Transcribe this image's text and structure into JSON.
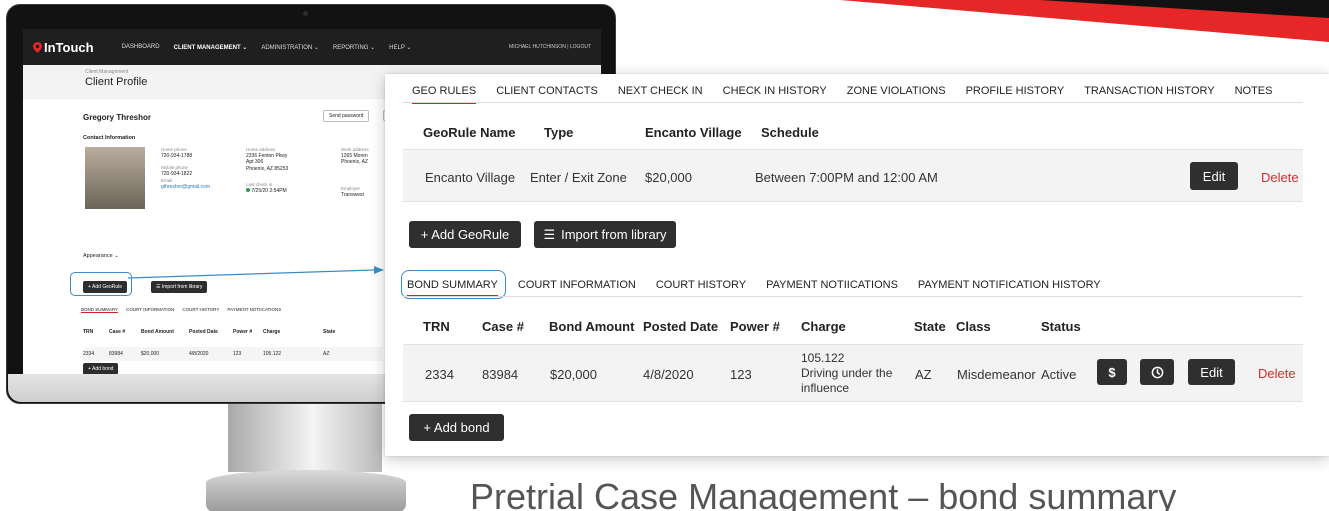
{
  "app": {
    "brand": "InTouch",
    "nav": [
      "DASHBOARD",
      "CLIENT MANAGEMENT",
      "ADMINISTRATION",
      "REPORTING",
      "HELP"
    ],
    "nav_active": "CLIENT MANAGEMENT",
    "user": "MICHAEL HUTCHINSON | LOGOUT",
    "breadcrumb": "Client Management",
    "page_title": "Client Profile",
    "client_name": "Gregory Threshor",
    "send_password": "Send password",
    "contact_heading": "Contact Information",
    "home_phone_label": "Home phone",
    "home_phone": "720-934-1788",
    "mobile_phone_label": "Mobile phone",
    "mobile_phone": "720-934-1822",
    "email_label": "Email",
    "email": "gthreshor@gmail.com",
    "home_address_label": "Home address",
    "home_address_1": "2336 Fenton Pkwy",
    "home_address_2": "Apt 306",
    "home_address_3": "Phoenix, AZ 85253",
    "last_checkin_label": "Last check in",
    "last_checkin": "7/25/20 2:54PM",
    "work_address_label": "Work address",
    "work_address_1": "1265 Moren",
    "work_address_2": "Phoenix, AZ",
    "employer_label": "Employer",
    "employer": "Transwest",
    "appearance": "Appearance",
    "add_georule": "Add GeoRule",
    "import_library": "Import from library",
    "add_bond": "Add bond"
  },
  "geo_tabs": [
    "GEO RULES",
    "CLIENT CONTACTS",
    "NEXT CHECK IN",
    "CHECK IN HISTORY",
    "ZONE VIOLATIONS",
    "PROFILE HISTORY",
    "TRANSACTION HISTORY",
    "NOTES"
  ],
  "geo_table": {
    "headers": [
      "GeoRule Name",
      "Type",
      "Encanto Village",
      "Schedule"
    ],
    "row": {
      "name": "Encanto Village",
      "type": "Enter / Exit Zone",
      "amount": "$20,000",
      "schedule": "Between 7:00PM and 12:00 AM"
    },
    "edit": "Edit",
    "delete": "Delete"
  },
  "geo_actions": {
    "add": "+ Add GeoRule",
    "import": "Import from library"
  },
  "bond_tabs": [
    "BOND SUMMARY",
    "COURT INFORMATION",
    "COURT HISTORY",
    "PAYMENT NOTIICATIONS",
    "PAYMENT NOTIFICATION HISTORY"
  ],
  "bond_table": {
    "headers": [
      "TRN",
      "Case #",
      "Bond Amount",
      "Posted Date",
      "Power #",
      "Charge",
      "State",
      "Class",
      "Status"
    ],
    "row": {
      "trn": "2334",
      "case": "83984",
      "amount": "$20,000",
      "posted": "4/8/2020",
      "power": "123",
      "charge_code": "105.122",
      "charge_line1": "Driving under the",
      "charge_line2": "influence",
      "state": "AZ",
      "class": "Misdemeanor",
      "status": "Active"
    },
    "dollar": "$",
    "edit": "Edit",
    "delete": "Delete"
  },
  "add_bond": "+ Add bond",
  "caption": "Pretrial Case Management – bond summary",
  "colors": {
    "accent_red": "#d5202a",
    "highlight_blue": "#3c8ec2",
    "dark_button": "#2f2f2f"
  },
  "icons": [
    "location-pin-icon",
    "list-icon",
    "clock-icon",
    "chevron-down-icon",
    "apple-logo"
  ]
}
